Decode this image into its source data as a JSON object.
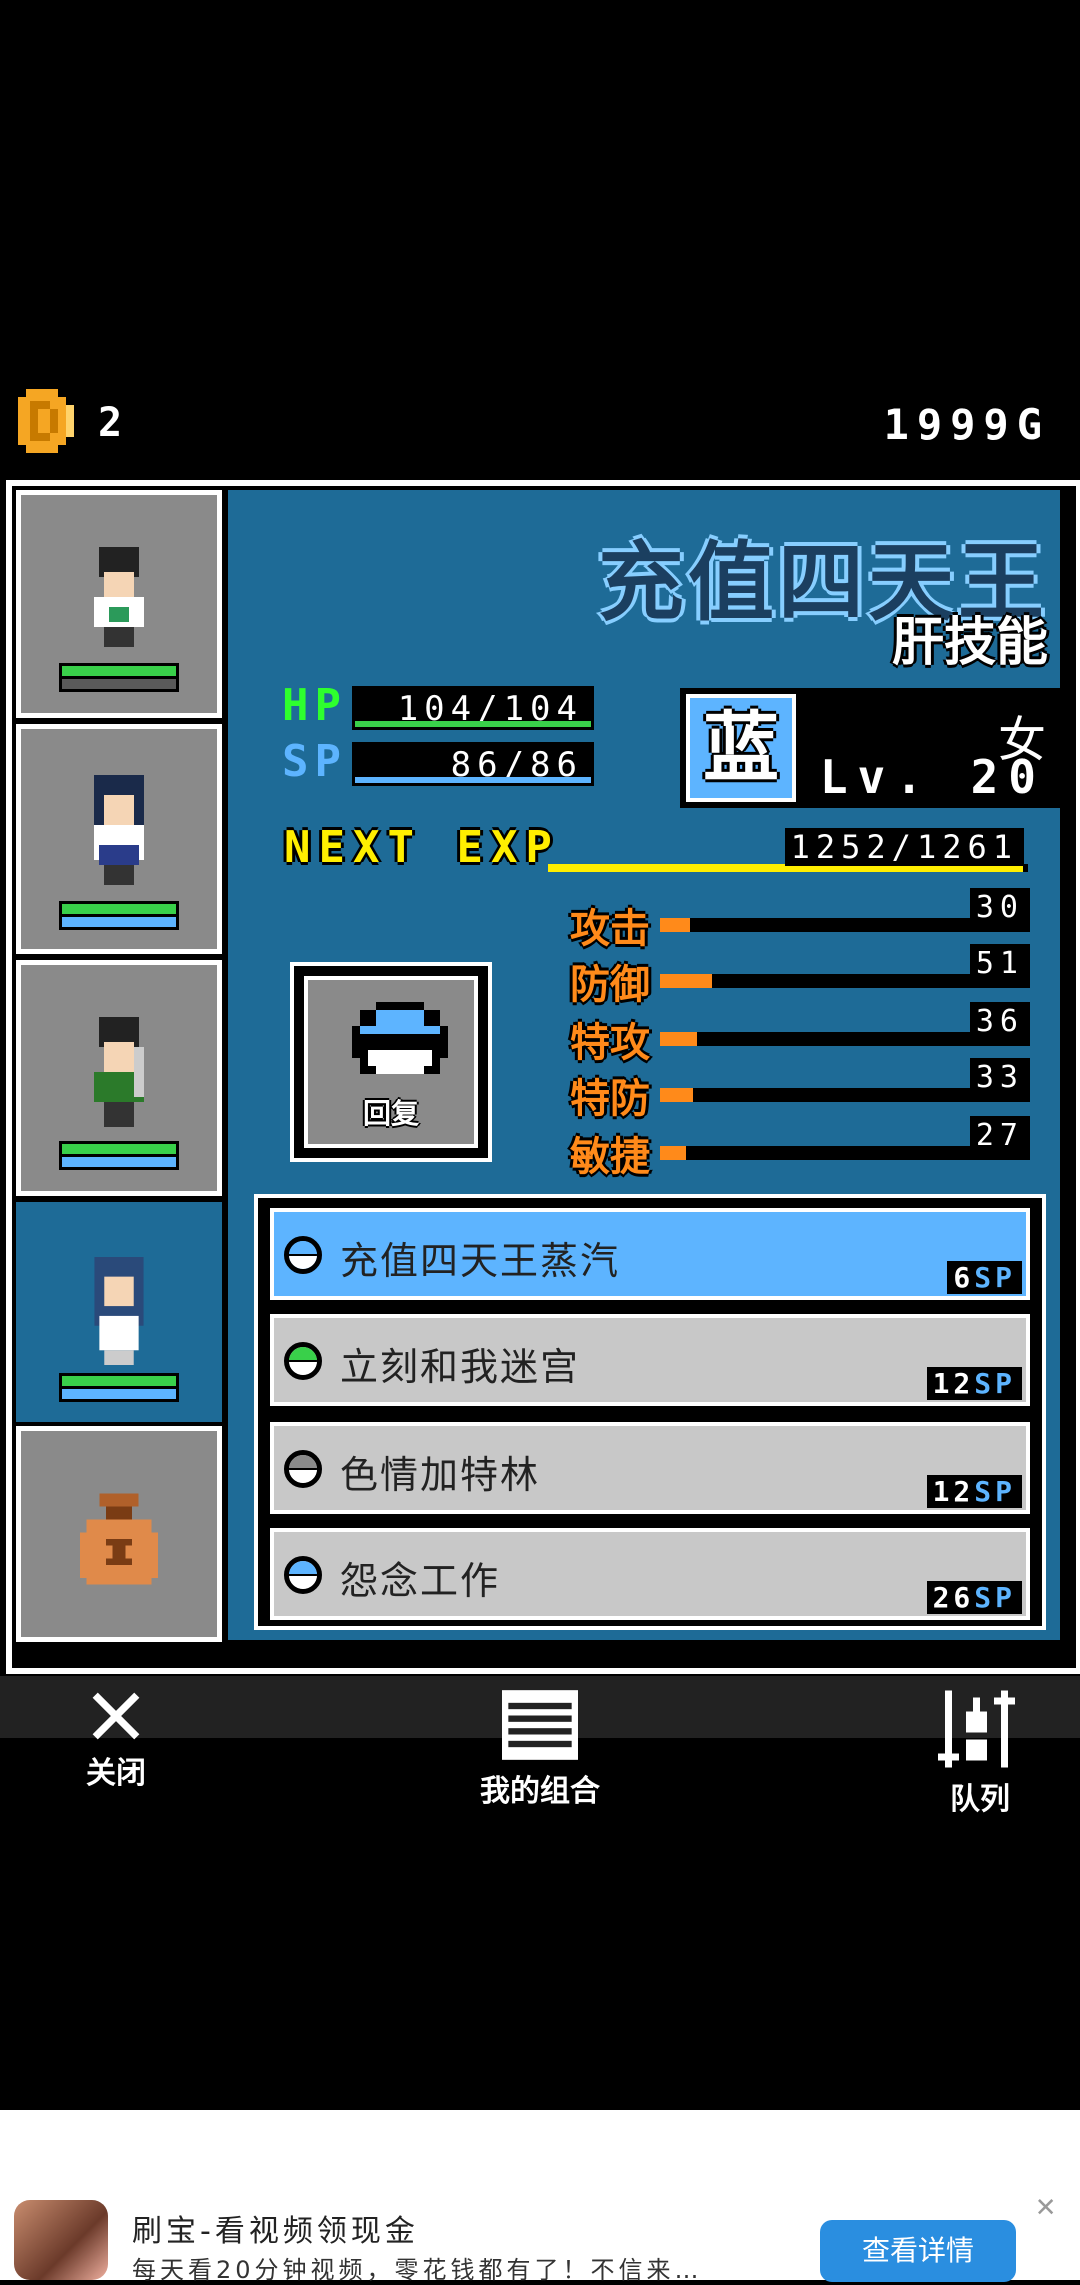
{
  "currency": {
    "coin_count": "2",
    "gold": "1999G"
  },
  "character": {
    "name": "充值四天王",
    "subtitle": "肝技能",
    "hp": "104/104",
    "sp": "86/86",
    "tag": "蓝",
    "gender": "女",
    "level": "Lv. 20",
    "next_exp_label": "NEXT EXP",
    "next_exp": "1252/1261",
    "next_exp_progress": 0.99
  },
  "stat_labels": {
    "hp": "HP",
    "sp": "SP"
  },
  "attributes": [
    {
      "name": "攻击",
      "value": "30",
      "fraction": 0.08
    },
    {
      "name": "防御",
      "value": "51",
      "fraction": 0.14
    },
    {
      "name": "特攻",
      "value": "36",
      "fraction": 0.1
    },
    {
      "name": "特防",
      "value": "33",
      "fraction": 0.09
    },
    {
      "name": "敏捷",
      "value": "27",
      "fraction": 0.07
    }
  ],
  "heal_button": {
    "label": "回复"
  },
  "skills": [
    {
      "name": "充值四天王蒸汽",
      "cost": "6",
      "unit": "SP",
      "orb": "#5db4ff",
      "selected": true
    },
    {
      "name": "立刻和我迷宫",
      "cost": "12",
      "unit": "SP",
      "orb": "#39d04a",
      "selected": false
    },
    {
      "name": "色情加特林",
      "cost": "12",
      "unit": "SP",
      "orb": "#8a8a8a",
      "selected": false
    },
    {
      "name": "怨念工作",
      "cost": "26",
      "unit": "SP",
      "orb": "#5db4ff",
      "selected": false
    }
  ],
  "nav": {
    "close": "关闭",
    "combo": "我的组合",
    "queue": "队列"
  },
  "ad": {
    "title": "刷宝-看视频领现金",
    "description": "每天看20分钟视频，零花钱都有了！不信来…",
    "button": "查看详情"
  },
  "colors": {
    "panel": "#1e6b97",
    "hp": "#39d04a",
    "sp": "#5db4ff",
    "exp": "#ffee00",
    "attr": "#ff8a1a"
  }
}
